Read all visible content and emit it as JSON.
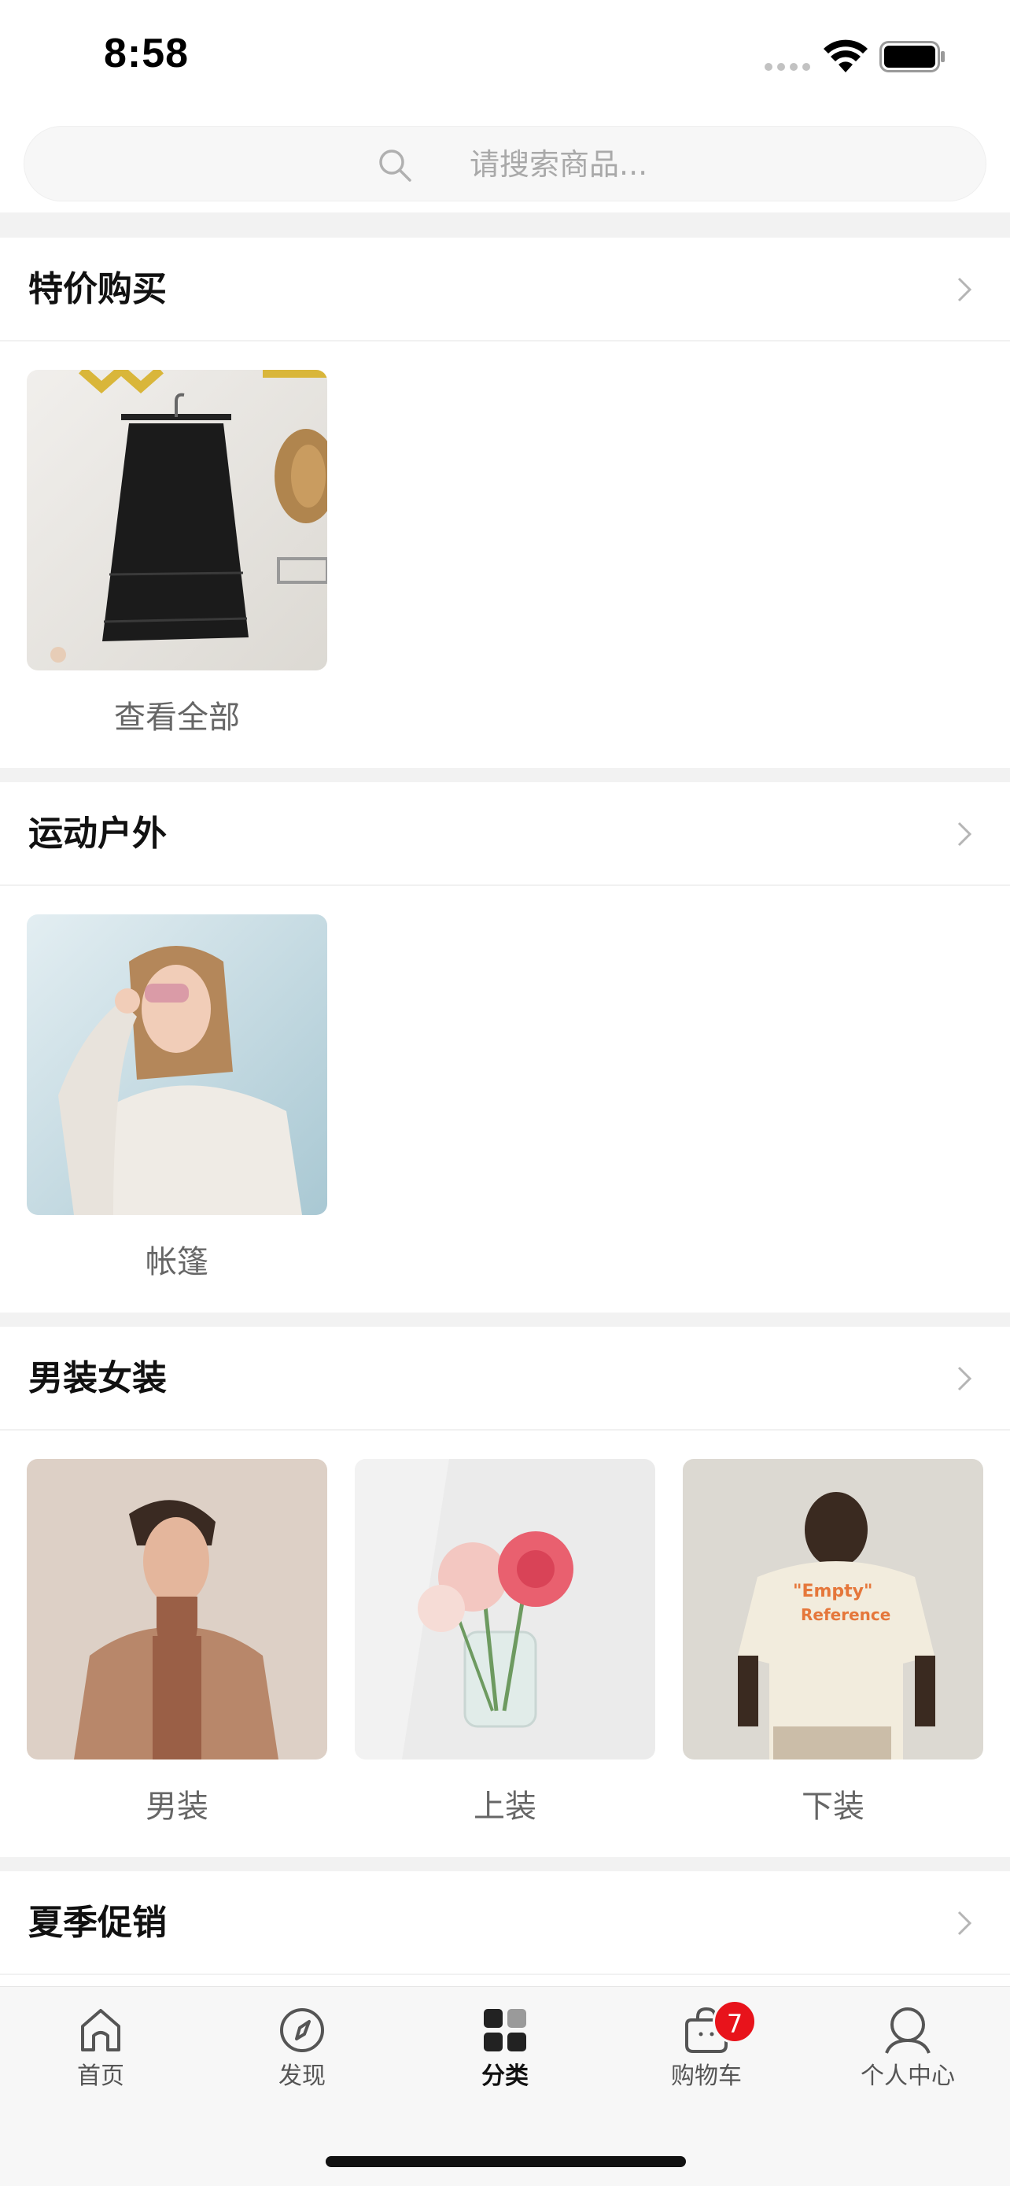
{
  "status": {
    "time": "8:58"
  },
  "search": {
    "placeholder": "请搜索商品..."
  },
  "sections": [
    {
      "title": "特价购买",
      "items": [
        {
          "label": "查看全部",
          "image": "black tulle skirt on hanger"
        }
      ]
    },
    {
      "title": "运动户外",
      "items": [
        {
          "label": "帐篷",
          "image": "woman in white knit sweater"
        }
      ]
    },
    {
      "title": "男装女装",
      "items": [
        {
          "label": "男装",
          "image": "man in camel coat"
        },
        {
          "label": "上装",
          "image": "pink flowers in glass vase"
        },
        {
          "label": "下装",
          "image": "man in cream tee, back view"
        }
      ]
    },
    {
      "title": "夏季促销",
      "items": []
    }
  ],
  "tabs": [
    {
      "label": "首页",
      "icon": "home-icon",
      "active": false
    },
    {
      "label": "发现",
      "icon": "compass-icon",
      "active": false
    },
    {
      "label": "分类",
      "icon": "category-grid-icon",
      "active": true
    },
    {
      "label": "购物车",
      "icon": "cart-bag-icon",
      "active": false,
      "badge": "7"
    },
    {
      "label": "个人中心",
      "icon": "user-icon",
      "active": false
    }
  ],
  "colors": {
    "badge": "#e8131b",
    "background": "#f2f2f2",
    "label": "#666666"
  }
}
